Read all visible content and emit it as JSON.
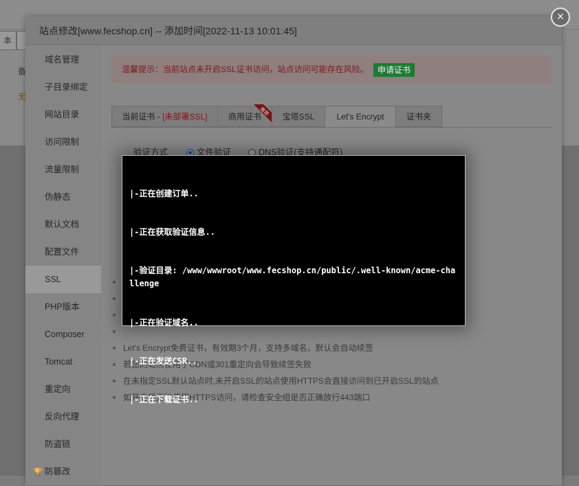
{
  "background": {
    "btn1": "本",
    "col_text": "备",
    "row_text": "无"
  },
  "dialog": {
    "title": "站点修改[www.fecshop.cn] -- 添加时间[2022-11-13 10:01:45]",
    "close_icon": "×"
  },
  "sidebar": {
    "items": [
      {
        "label": "域名管理"
      },
      {
        "label": "子目录绑定"
      },
      {
        "label": "网站目录"
      },
      {
        "label": "访问限制"
      },
      {
        "label": "流量限制"
      },
      {
        "label": "伪静态"
      },
      {
        "label": "默认文档"
      },
      {
        "label": "配置文件"
      },
      {
        "label": "SSL",
        "active": true
      },
      {
        "label": "PHP版本"
      },
      {
        "label": "Composer"
      },
      {
        "label": "Tomcat"
      },
      {
        "label": "重定向"
      },
      {
        "label": "反向代理"
      },
      {
        "label": "防盗链"
      },
      {
        "label": "防篡改",
        "icon": "trophy-icon"
      }
    ]
  },
  "notice": {
    "text": "温馨提示：当前站点未开启SSL证书访问，站点访问可能存在风险。",
    "button": "申请证书"
  },
  "tabs": {
    "current_prefix": "当前证书 - ",
    "current_status": "[未部署SSL]",
    "commercial": "商用证书",
    "ribbon": "推荐",
    "baota": "宝塔SSL",
    "letsencrypt": "Let's Encrypt",
    "cert_folder": "证书夹"
  },
  "verify": {
    "label": "验证方式",
    "option_file": "文件验证",
    "option_dns": "DNS验证(支持通配符)",
    "selected": "文件验证"
  },
  "tips": [
    "Let's Encrypt免费证书，有效期3个月，支持多域名。默认会自动续签",
    "若您的站点使用了CDN或301重定向会导致续签失败",
    "在未指定SSL默认站点时,未开启SSL的站点使用HTTPS会直接访问到已开启SSL的站点",
    "如开启后无法使用HTTPS访问，请检查安全组是否正确放行443端口"
  ],
  "terminal": {
    "lines": [
      "|-正在创建订单..",
      "|-正在获取验证信息..",
      "|-验证目录: /www/wwwroot/www.fecshop.cn/public/.well-known/acme-challenge",
      "|-正在验证域名..",
      "|-正在发送CSR..",
      "|-正在下载证书.."
    ]
  },
  "colors": {
    "accent_green": "#20a53a",
    "warning_red": "#c7254e",
    "terminal_bg": "#000000"
  }
}
